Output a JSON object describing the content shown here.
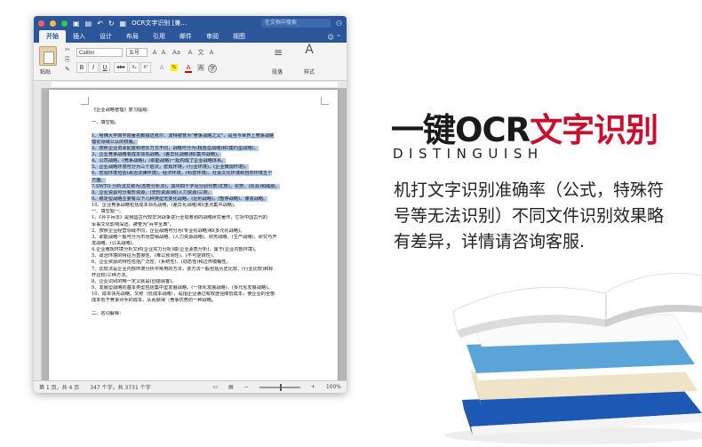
{
  "window": {
    "title": "OCR文字识别 [兼...",
    "search_placeholder": "在文档中搜索",
    "tabs": [
      "开始",
      "插入",
      "设计",
      "布局",
      "引用",
      "邮件",
      "审阅",
      "视图"
    ],
    "ribbon": {
      "paste_label": "粘贴",
      "font_name": "Calibri",
      "font_size": "五号",
      "paragraph_label": "段落",
      "styles_label": "样式",
      "bold": "B",
      "italic": "I",
      "underline": "U",
      "strike": "abc",
      "subscript": "X₂",
      "superscript": "X²"
    },
    "document_lines": [
      {
        "text": "《企业战略管理》复习提纲：",
        "hl": false
      },
      {
        "text": "",
        "hl": false
      },
      {
        "text": "一、填空题。",
        "hl": false
      },
      {
        "text": "",
        "hl": false
      },
      {
        "text": "1、哈佛大学商学院著名教授迈克尔．波特被誉为\"竞争战略之父\"，是当今世界上竞争战略",
        "hl": true
      },
      {
        "text": "理论领域公认的权威。",
        "hl": true
      },
      {
        "text": "2、按照企业资源配置和增长方式不同，战略可分为(粗放型战略)和(集约型战略)。",
        "hl": true
      },
      {
        "text": "3、企业竞争战略有成本领先战略、(差异化战略)和(集中战略)。",
        "hl": true
      },
      {
        "text": "4、公司战略，(竞争战略)，(职能战略)一起构成了企业战略体系。",
        "hl": true
      },
      {
        "text": "5、企业战略环境可分为三个层次，宏观环境，(行业环境)，(企业微观环境)。",
        "hl": true
      },
      {
        "text": "6、宏观环境包括(政治法律环境)，经济环境，(科技环境)，社会文化环境和自然环境五个",
        "hl": true
      },
      {
        "text": "方面。",
        "hl": true
      },
      {
        "text": "7.SWTO 分析法又称为(态势分析法)，其中四个字母分别代表(优势)，劣势，(机会)和威胁。",
        "hl": true
      },
      {
        "text": "8、企业资源可分有形资源，(无形资源)和(人力资源)三类。",
        "hl": true
      },
      {
        "text": "9、稳定型战略主要有以下几种类型无变化战略，(近利战略)，(暂停战略)，谨造战略。",
        "hl": true
      },
      {
        "text": "10、企业竞争战略包括成本领先战略，(差异化战略)和(重点集中战略)。",
        "hl": false
      },
      {
        "text": "一、填空题一。",
        "hl": false
      },
      {
        "text": "1、《孙子兵法》是我国古代较早对战争进行全局筹划的战略研究著作，它对中国古代的",
        "hl": false
      },
      {
        "text": "军事文化影响深远，被誉为\"兵学圣典\"。",
        "hl": false
      },
      {
        "text": "2、按照企业经营领域不同，企业战略可分为(专业化战略)和(多元化战略)。",
        "hl": false
      },
      {
        "text": "3、职能战略一般可分为市场营销战略、(人力资源战略)、财务战略、(生产战略)、研究与开",
        "hl": false
      },
      {
        "text": "发战略、(公关战略)。",
        "hl": false
      },
      {
        "text": "4.企业微观环境分析又称(企业实力分析)或(企业素质分析)，属于(企业内部环境)。",
        "hl": false
      },
      {
        "text": "5、政治环境的特征为直接性、(难以预测性)、(不可逆转性)。",
        "hl": false
      },
      {
        "text": "6、企业资源的特性包括广泛性、(系统性)、(动态性)和边界模糊性。",
        "hl": false
      },
      {
        "text": "7、比较法是企业内部环境分析中常用的方法，该方法一般包括历史比较、(行业比较)和标",
        "hl": false
      },
      {
        "text": "杆比较)三种方法。",
        "hl": false
      },
      {
        "text": "8、企业识别的唯一定义就是(创造顾客)。",
        "hl": false
      },
      {
        "text": "9、发展型战略的基本类型包括集中型发展战略，(一体化发展战略)，(多元化发展战略)。",
        "hl": false
      },
      {
        "text": "10、成本领先战略，又称（低成本战略），是指企业通过有效途径降低成本，使企业的全部",
        "hl": false
      },
      {
        "text": "成本低于竞争对手的成本，从而获得（竞争优势的一种战略。",
        "hl": false
      },
      {
        "text": "",
        "hl": false
      },
      {
        "text": "二、名词解释：",
        "hl": false
      }
    ],
    "status": {
      "page": "第 1 页，共 4 页",
      "words": "347 个字，共 3731 个字",
      "zoom": "100%"
    }
  },
  "headline": {
    "part1": "一键OCR",
    "part2": "文字识别"
  },
  "subtitle_en": "DISTINGUISH",
  "body": "机打文字识别准确率（公式，特殊符号等无法识别）不同文件识别效果略有差异，详情请咨询客服.",
  "colors": {
    "accent_red": "#c8102e",
    "word_blue": "#2b579a",
    "highlight": "#b6cdf0"
  }
}
